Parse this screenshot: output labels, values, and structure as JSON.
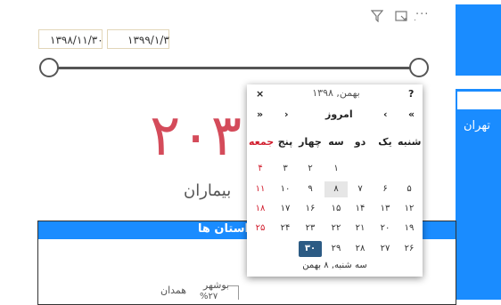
{
  "sidebar": {
    "city_label": "تهران"
  },
  "toolbar": {
    "more_label": "···",
    "dot_label": "."
  },
  "date_range": {
    "from": "۱۳۹۸/۱۱/۳۰",
    "to": "۱۳۹۹/۱/۳"
  },
  "kpi": {
    "value": "۲۰۳",
    "label": "بیماران"
  },
  "table": {
    "title": "استان ها",
    "pie_labels": [
      "بوشهر",
      "همدان",
      "%۲۷"
    ]
  },
  "calendar": {
    "help": "?",
    "close": "×",
    "month_title": "بهمن, ۱۳۹۸",
    "prev_year": "«",
    "prev_month": "‹",
    "today": "امروز",
    "next_month": "›",
    "next_year": "»",
    "weekdays": [
      "جمعه",
      "پنج",
      "چهار",
      "سه",
      "دو",
      "یک",
      "شنبه"
    ],
    "weeks": [
      [
        "",
        "",
        "",
        "۱",
        "",
        "",
        ""
      ],
      [
        "۴",
        "۳",
        "۲",
        "۱",
        "",
        "",
        ""
      ],
      [
        "۱۱",
        "۱۰",
        "۹",
        "۸",
        "۷",
        "۶",
        "۵"
      ],
      [
        "۱۸",
        "۱۷",
        "۱۶",
        "۱۵",
        "۱۴",
        "۱۳",
        "۱۲"
      ],
      [
        "۲۵",
        "۲۴",
        "۲۳",
        "۲۲",
        "۲۱",
        "۲۰",
        "۱۹"
      ],
      [
        "",
        "",
        "۳۰",
        "۲۹",
        "۲۸",
        "۲۷",
        "۲۶"
      ]
    ],
    "selected_day": "۳۰",
    "footer": "سه شنبه, ۸ بهمن"
  }
}
